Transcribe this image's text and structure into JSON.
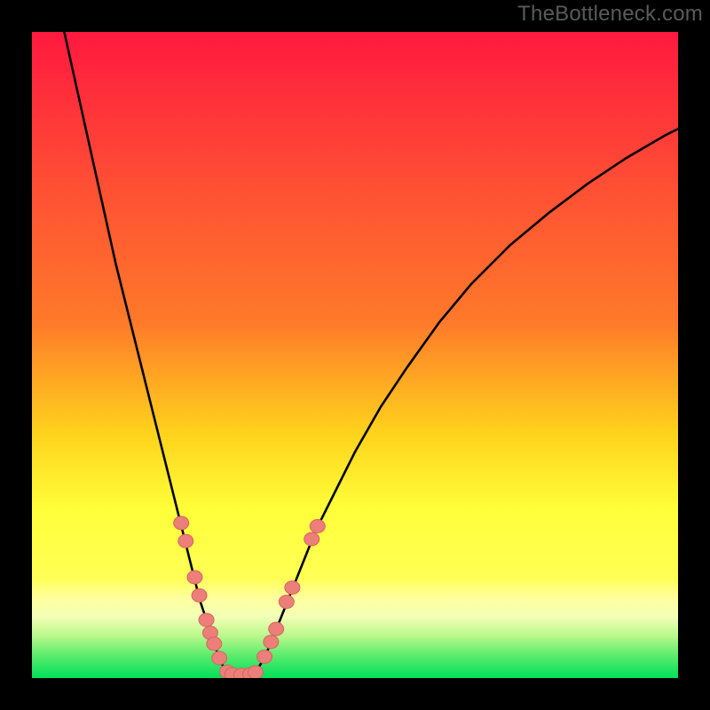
{
  "watermark": "TheBottleneck.com",
  "colors": {
    "frame": "#000000",
    "gradient_top": "#ff193f",
    "gradient_mid1": "#ff7a2a",
    "gradient_mid2": "#ffd21c",
    "gradient_mid3": "#ffff3a",
    "gradient_band_light": "#ffff9c",
    "gradient_bottom": "#00e05a",
    "curve": "#000000",
    "marker_fill": "#ec7f79",
    "marker_stroke": "#d5645e"
  },
  "chart_data": {
    "type": "line",
    "title": "",
    "xlabel": "",
    "ylabel": "",
    "xlim": [
      0,
      100
    ],
    "ylim": [
      0,
      100
    ],
    "series": [
      {
        "name": "left-curve",
        "x": [
          5,
          7,
          9,
          11,
          13,
          15,
          17,
          19,
          20,
          21,
          22,
          23,
          24,
          25,
          26,
          27,
          28,
          28.5,
          29,
          29.5,
          30,
          30.5
        ],
        "values": [
          100,
          91,
          82,
          73,
          64,
          56,
          48,
          40,
          36,
          32,
          28,
          24,
          20,
          16,
          12,
          9,
          6,
          4.5,
          3,
          2,
          1.2,
          0.8
        ]
      },
      {
        "name": "right-curve",
        "x": [
          34.5,
          35,
          36,
          37,
          38,
          40,
          42,
          44,
          47,
          50,
          54,
          58,
          63,
          68,
          74,
          80,
          86,
          92,
          98,
          100
        ],
        "values": [
          0.8,
          1.5,
          3.2,
          5.5,
          8,
          13,
          18,
          23,
          29,
          35,
          42,
          48,
          55,
          61,
          67,
          72,
          76.5,
          80.5,
          84,
          85
        ]
      },
      {
        "name": "valley-floor",
        "x": [
          30.5,
          31,
          32,
          33,
          34,
          34.5
        ],
        "values": [
          0.8,
          0.5,
          0.4,
          0.4,
          0.5,
          0.8
        ]
      }
    ],
    "markers": [
      {
        "x": 23.1,
        "y": 24.0
      },
      {
        "x": 23.8,
        "y": 21.2
      },
      {
        "x": 25.2,
        "y": 15.6
      },
      {
        "x": 25.9,
        "y": 12.8
      },
      {
        "x": 27.0,
        "y": 9.0
      },
      {
        "x": 27.6,
        "y": 7.0
      },
      {
        "x": 28.2,
        "y": 5.3
      },
      {
        "x": 29.0,
        "y": 3.1
      },
      {
        "x": 30.2,
        "y": 1.0
      },
      {
        "x": 31.0,
        "y": 0.6
      },
      {
        "x": 32.4,
        "y": 0.5
      },
      {
        "x": 33.8,
        "y": 0.6
      },
      {
        "x": 34.6,
        "y": 0.9
      },
      {
        "x": 36.0,
        "y": 3.3
      },
      {
        "x": 37.0,
        "y": 5.6
      },
      {
        "x": 37.8,
        "y": 7.6
      },
      {
        "x": 39.4,
        "y": 11.8
      },
      {
        "x": 40.3,
        "y": 14.0
      },
      {
        "x": 43.3,
        "y": 21.5
      },
      {
        "x": 44.2,
        "y": 23.5
      }
    ]
  }
}
